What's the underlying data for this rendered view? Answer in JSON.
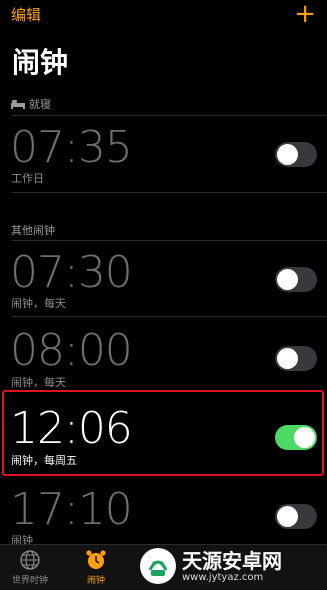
{
  "header": {
    "edit_label": "编辑",
    "add_label": "+",
    "title": "闹钟"
  },
  "sections": {
    "sleep": "就寝",
    "other": "其他闹钟"
  },
  "alarms": [
    {
      "time": "07:35",
      "label": "工作日",
      "enabled": false
    },
    {
      "time": "07:30",
      "label": "闹钟，每天",
      "enabled": false
    },
    {
      "time": "08:00",
      "label": "闹钟，每天",
      "enabled": false
    },
    {
      "time": "12:06",
      "label": "闹钟，每周五",
      "enabled": true
    },
    {
      "time": "17:10",
      "label": "闹钟",
      "enabled": false
    }
  ],
  "tabs": [
    {
      "label": "世界时钟",
      "icon": "globe-icon",
      "active": false
    },
    {
      "label": "闹钟",
      "icon": "alarm-clock-icon",
      "active": true
    }
  ],
  "watermark": {
    "name": "天源安卓网",
    "url": "www.jytyaz.com"
  },
  "colors": {
    "accent": "#ff9f0a",
    "toggle_on": "#4cd964",
    "highlight": "#e0141e"
  }
}
